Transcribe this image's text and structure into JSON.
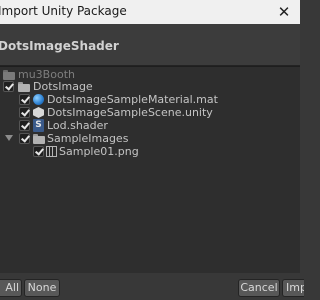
{
  "window": {
    "title": "Import Unity Package",
    "close_glyph": "✕"
  },
  "header": {
    "package_name": "DotsImageShader"
  },
  "tree": {
    "root": {
      "label": "mu3Booth"
    },
    "dots_folder": {
      "label": "DotsImage"
    },
    "material": {
      "label": "DotsImageSampleMaterial.mat"
    },
    "scene": {
      "label": "DotsImageSampleScene.unity"
    },
    "shader": {
      "label": "Lod.shader",
      "icon_glyph": "S"
    },
    "samples_folder": {
      "label": "SampleImages"
    },
    "sample_png": {
      "label": "Sample01.png"
    }
  },
  "footer": {
    "all_label": "All",
    "none_label": "None",
    "cancel_label": "Cancel",
    "import_label": "Import"
  }
}
